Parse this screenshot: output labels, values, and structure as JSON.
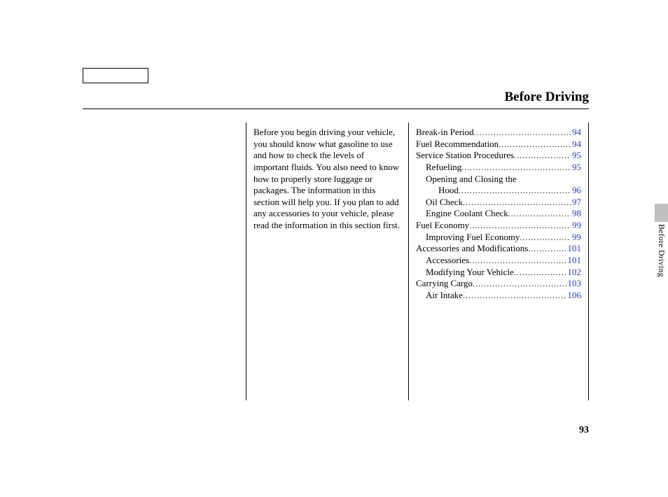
{
  "page_title": "Before Driving",
  "side_tab_label": "Before Driving",
  "page_number": "93",
  "intro_text": "Before you begin driving your vehicle, you should know what gasoline to use and how to check the levels of important fluids. You also need to know how to properly store luggage or packages. The information in this section will help you. If you plan to add any accessories to your vehicle, please read the information in this section first.",
  "toc": [
    {
      "label": "Break-in Period",
      "page": "94",
      "indent": 0
    },
    {
      "label": "Fuel Recommendation",
      "page": "94",
      "indent": 0
    },
    {
      "label": "Service Station Procedures",
      "page": "95",
      "indent": 0
    },
    {
      "label": "Refueling",
      "page": "95",
      "indent": 1
    },
    {
      "label": "Opening and Closing the",
      "page": "",
      "indent": 1,
      "no_dots": true
    },
    {
      "label": "Hood",
      "page": "96",
      "indent": 2
    },
    {
      "label": "Oil Check",
      "page": "97",
      "indent": 1
    },
    {
      "label": "Engine Coolant Check",
      "page": "98",
      "indent": 1
    },
    {
      "label": "Fuel Economy",
      "page": "99",
      "indent": 0
    },
    {
      "label": "Improving Fuel Economy",
      "page": "99",
      "indent": 1
    },
    {
      "label": "Accessories and Modifications",
      "page": "101",
      "indent": 0
    },
    {
      "label": "Accessories",
      "page": "101",
      "indent": 1
    },
    {
      "label": "Modifying Your Vehicle",
      "page": "102",
      "indent": 1
    },
    {
      "label": "Carrying Cargo",
      "page": "103",
      "indent": 0
    },
    {
      "label": "Air Intake",
      "page": "106",
      "indent": 1
    }
  ]
}
